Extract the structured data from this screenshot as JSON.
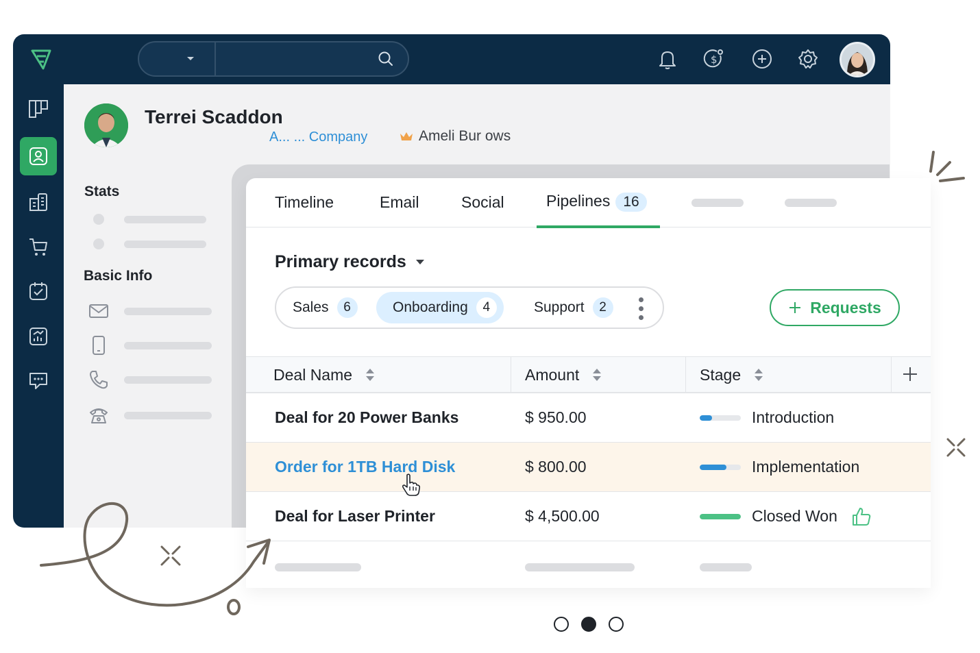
{
  "contact": {
    "name": "Terrei Scaddon",
    "company": "A... ... Company",
    "owner": "Ameli  Bur  ows"
  },
  "left_panel": {
    "stats_title": "Stats",
    "basic_info_title": "Basic Info"
  },
  "tabs": [
    {
      "label": "Timeline"
    },
    {
      "label": "Email"
    },
    {
      "label": "Social"
    },
    {
      "label": "Pipelines",
      "count": "16",
      "active": true
    }
  ],
  "records": {
    "title": "Primary records",
    "segments": [
      {
        "label": "Sales",
        "count": "6"
      },
      {
        "label": "Onboarding",
        "count": "4",
        "active": true
      },
      {
        "label": "Support",
        "count": "2"
      }
    ],
    "requests_label": "Requests"
  },
  "table": {
    "columns": [
      "Deal Name",
      "Amount",
      "Stage"
    ],
    "rows": [
      {
        "name": "Deal for 20 Power Banks",
        "amount": "$ 950.00",
        "stage": "Introduction",
        "progress": 0.3,
        "color": "#2e8fd6"
      },
      {
        "name": "Order for 1TB Hard Disk",
        "amount": "$ 800.00",
        "stage": "Implementation",
        "progress": 0.65,
        "color": "#2e8fd6",
        "highlighted": true
      },
      {
        "name": "Deal for Laser Printer",
        "amount": "$ 4,500.00",
        "stage": "Closed Won",
        "progress": 1.0,
        "color": "#4cc185"
      }
    ]
  },
  "colors": {
    "nav": "#0c2b45",
    "accent_green": "#2fa864",
    "link_blue": "#2e8fd6",
    "badge_blue": "#dcefff",
    "row_highlight": "#fdf5ea"
  },
  "icons": {
    "topbar": [
      "bell-icon",
      "dollar-gear-icon",
      "plus-circle-icon",
      "settings-icon"
    ],
    "sidebar": [
      "board-icon",
      "contact-icon",
      "building-icon",
      "cart-icon",
      "calendar-check-icon",
      "report-icon",
      "chat-icon"
    ],
    "basic_info": [
      "mail-icon",
      "mobile-icon",
      "phone-icon",
      "telephone-icon"
    ]
  },
  "pager": {
    "count": 3,
    "active": 1
  }
}
